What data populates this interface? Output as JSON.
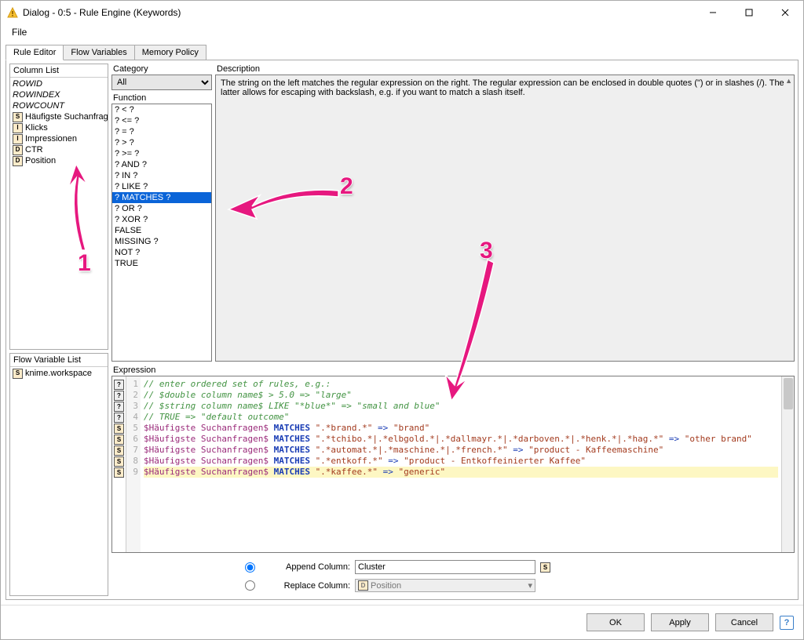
{
  "titlebar": {
    "title": "Dialog - 0:5 - Rule Engine (Keywords)"
  },
  "menubar": {
    "file": "File"
  },
  "tabs": {
    "ruleEditor": "Rule Editor",
    "flowVariables": "Flow Variables",
    "memoryPolicy": "Memory Policy"
  },
  "columnList": {
    "header": "Column List",
    "items": [
      {
        "name": "ROWID",
        "type": "",
        "italic": true
      },
      {
        "name": "ROWINDEX",
        "type": "",
        "italic": true
      },
      {
        "name": "ROWCOUNT",
        "type": "",
        "italic": true
      },
      {
        "name": "Häufigste Suchanfragen",
        "type": "S"
      },
      {
        "name": "Klicks",
        "type": "I"
      },
      {
        "name": "Impressionen",
        "type": "I"
      },
      {
        "name": "CTR",
        "type": "D"
      },
      {
        "name": "Position",
        "type": "D"
      }
    ]
  },
  "flowVarList": {
    "header": "Flow Variable List",
    "items": [
      {
        "name": "knime.workspace",
        "type": "S"
      }
    ]
  },
  "category": {
    "label": "Category",
    "selected": "All"
  },
  "function": {
    "label": "Function",
    "items": [
      "? < ?",
      "? <= ?",
      "? = ?",
      "? > ?",
      "? >= ?",
      "? AND ?",
      "? IN ?",
      "? LIKE ?",
      "? MATCHES ?",
      "? OR ?",
      "? XOR ?",
      "FALSE",
      "MISSING ?",
      "NOT ?",
      "TRUE"
    ],
    "selectedIndex": 8
  },
  "description": {
    "label": "Description",
    "text": "The string on the left matches the regular expression on the right. The regular expression can be enclosed in double quotes (\") or in slashes (/). The latter allows for escaping with backslash, e.g. if you want to match a slash itself."
  },
  "expression": {
    "label": "Expression",
    "gutterTypes": [
      "?",
      "?",
      "?",
      "?",
      "S",
      "S",
      "S",
      "S",
      "S"
    ],
    "lines": [
      {
        "n": 1,
        "t": "comment",
        "text": "// enter ordered set of rules, e.g.:"
      },
      {
        "n": 2,
        "t": "comment",
        "text": "// $double column name$ > 5.0 => \"large\""
      },
      {
        "n": 3,
        "t": "comment",
        "text": "// $string column name$ LIKE \"*blue*\" => \"small and blue\""
      },
      {
        "n": 4,
        "t": "comment",
        "text": "// TRUE => \"default outcome\""
      },
      {
        "n": 5,
        "t": "rule",
        "col": "$Häufigste Suchanfragen$",
        "kw": "MATCHES",
        "pat": "\".*brand.*\"",
        "out": "\"brand\""
      },
      {
        "n": 6,
        "t": "rule",
        "col": "$Häufigste Suchanfragen$",
        "kw": "MATCHES",
        "pat": "\".*tchibo.*|.*elbgold.*|.*dallmayr.*|.*darboven.*|.*henk.*|.*hag.*\"",
        "out": "\"other brand\""
      },
      {
        "n": 7,
        "t": "rule",
        "col": "$Häufigste Suchanfragen$",
        "kw": "MATCHES",
        "pat": "\".*automat.*|.*maschine.*|.*french.*\"",
        "out": "\"product - Kaffeemaschine\""
      },
      {
        "n": 8,
        "t": "rule",
        "col": "$Häufigste Suchanfragen$",
        "kw": "MATCHES",
        "pat": "\".*entkoff.*\"",
        "out": "\"product - Entkoffeinierter Kaffee\""
      },
      {
        "n": 9,
        "t": "rule",
        "col": "$Häufigste Suchanfragen$",
        "kw": "MATCHES",
        "pat": "\".*kaffee.*\"",
        "out": "\"generic\"",
        "hl": true
      }
    ]
  },
  "outputOptions": {
    "appendLabel": "Append Column:",
    "appendValue": "Cluster",
    "appendType": "S",
    "replaceLabel": "Replace Column:",
    "replaceValue": "Position",
    "replaceType": "D",
    "selected": "append"
  },
  "buttons": {
    "ok": "OK",
    "apply": "Apply",
    "cancel": "Cancel"
  },
  "annotations": {
    "a1": "1",
    "a2": "2",
    "a3": "3"
  }
}
